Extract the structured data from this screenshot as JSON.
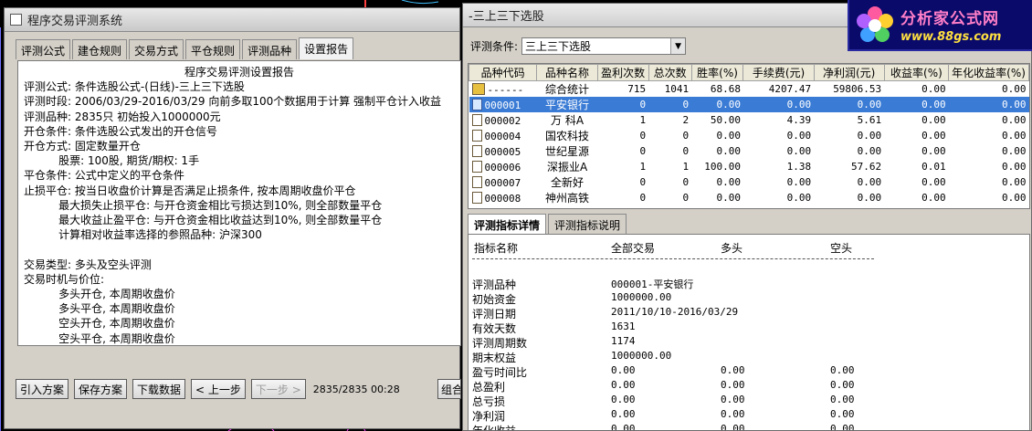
{
  "left_window": {
    "title": "程序交易评测系统",
    "tabs": [
      "评测公式",
      "建仓规则",
      "交易方式",
      "平仓规则",
      "评测品种",
      "设置报告"
    ],
    "active_tab": "设置报告",
    "report": {
      "title": "程序交易评测设置报告",
      "lines": [
        "评测公式: 条件选股公式-(日线)-三上三下选股",
        "评测时段: 2006/03/29-2016/03/29 向前多取100个数据用于计算 强制平仓计入收益",
        "评测品种: 2835只 初始投入1000000元",
        "开仓条件: 条件选股公式发出的开仓信号",
        "开仓方式: 固定数量开仓",
        "          股票: 100股, 期货/期权: 1手",
        "平仓条件: 公式中定义的平仓条件",
        "止损平仓: 按当日收盘价计算是否满足止损条件, 按本周期收盘价平仓",
        "          最大损失止损平仓: 与开仓资金相比亏损达到10%, 则全部数量平仓",
        "          最大收益止盈平仓: 与开仓资金相比收益达到10%, 则全部数量平仓",
        "          计算相对收益率选择的参照品种: 沪深300",
        "",
        "交易类型: 多头及空头评测",
        "交易时机与价位:",
        "          多头开仓, 本周期收盘价",
        "          多头平仓, 本周期收盘价",
        "          空头开仓, 本周期收盘价",
        "          空头平仓, 本周期收盘价"
      ]
    },
    "buttons": {
      "import": "引入方案",
      "save": "保存方案",
      "download": "下载数据",
      "prev": "< 上一步",
      "next": "下一步 >",
      "partial": "组合"
    },
    "status": "2835/2835 00:28"
  },
  "right_window": {
    "title": "-三上三下选股",
    "condition_label": "评测条件:",
    "condition_value": "三上三下选股",
    "columns": [
      "品种代码",
      "品种名称",
      "盈利次数",
      "总次数",
      "胜率(%)",
      "手续费(元)",
      "净利润(元)",
      "收益率(%)",
      "年化收益率(%)"
    ],
    "rows": [
      {
        "icon": "summary",
        "code": "------",
        "name": "综合统计",
        "wins": "715",
        "total": "1041",
        "rate": "68.68",
        "fee": "4207.47",
        "profit": "59806.53",
        "ret": "0.00",
        "annual": "0.00",
        "selected": false
      },
      {
        "icon": "doc-blue",
        "code": "000001",
        "name": "平安银行",
        "wins": "0",
        "total": "0",
        "rate": "0.00",
        "fee": "0.00",
        "profit": "0.00",
        "ret": "0.00",
        "annual": "0.00",
        "selected": true
      },
      {
        "icon": "doc",
        "code": "000002",
        "name": "万 科A",
        "wins": "1",
        "total": "2",
        "rate": "50.00",
        "fee": "4.39",
        "profit": "5.61",
        "ret": "0.00",
        "annual": "0.00",
        "selected": false
      },
      {
        "icon": "doc",
        "code": "000004",
        "name": "国农科技",
        "wins": "0",
        "total": "0",
        "rate": "0.00",
        "fee": "0.00",
        "profit": "0.00",
        "ret": "0.00",
        "annual": "0.00",
        "selected": false
      },
      {
        "icon": "doc",
        "code": "000005",
        "name": "世纪星源",
        "wins": "0",
        "total": "0",
        "rate": "0.00",
        "fee": "0.00",
        "profit": "0.00",
        "ret": "0.00",
        "annual": "0.00",
        "selected": false
      },
      {
        "icon": "doc",
        "code": "000006",
        "name": "深振业A",
        "wins": "1",
        "total": "1",
        "rate": "100.00",
        "fee": "1.38",
        "profit": "57.62",
        "ret": "0.01",
        "annual": "0.00",
        "selected": false
      },
      {
        "icon": "doc",
        "code": "000007",
        "name": "全新好",
        "wins": "0",
        "total": "0",
        "rate": "0.00",
        "fee": "0.00",
        "profit": "0.00",
        "ret": "0.00",
        "annual": "0.00",
        "selected": false
      },
      {
        "icon": "doc",
        "code": "000008",
        "name": "神州高铁",
        "wins": "0",
        "total": "0",
        "rate": "0.00",
        "fee": "0.00",
        "profit": "0.00",
        "ret": "0.00",
        "annual": "0.00",
        "selected": false
      }
    ],
    "detail_tabs": [
      "评测指标详情",
      "评测指标说明"
    ],
    "detail_header": {
      "name": "指标名称",
      "all": "全部交易",
      "long": "多头",
      "short": "空头"
    },
    "detail_rows": [
      {
        "name": "",
        "all": "",
        "long": "",
        "short": ""
      },
      {
        "name": "评测品种",
        "all": "000001-平安银行",
        "long": "",
        "short": ""
      },
      {
        "name": "初始资金",
        "all": "1000000.00",
        "long": "",
        "short": ""
      },
      {
        "name": "评测日期",
        "all": "2011/10/10-2016/03/29",
        "long": "",
        "short": ""
      },
      {
        "name": "有效天数",
        "all": "1631",
        "long": "",
        "short": ""
      },
      {
        "name": "评测周期数",
        "all": "1174",
        "long": "",
        "short": ""
      },
      {
        "name": "期末权益",
        "all": "1000000.00",
        "long": "",
        "short": ""
      },
      {
        "name": "盈亏时间比",
        "all": "0.00",
        "long": "0.00",
        "short": "0.00"
      },
      {
        "name": "总盈利",
        "all": "0.00",
        "long": "0.00",
        "short": "0.00"
      },
      {
        "name": "总亏损",
        "all": "0.00",
        "long": "0.00",
        "short": "0.00"
      },
      {
        "name": "净利润",
        "all": "0.00",
        "long": "0.00",
        "short": "0.00"
      },
      {
        "name": "年化收益",
        "all": "0.00",
        "long": "0.00",
        "short": "0.00"
      }
    ]
  },
  "watermark": {
    "brand": "分析家公式网",
    "url": "www.88gs.com"
  },
  "colors": {
    "selection": "#3a7bd5",
    "window_bg": "#d4d0c8",
    "logo_bg": "#0a0a6a",
    "logo_text": "#ff7fc8",
    "logo_url": "#ffe040"
  }
}
